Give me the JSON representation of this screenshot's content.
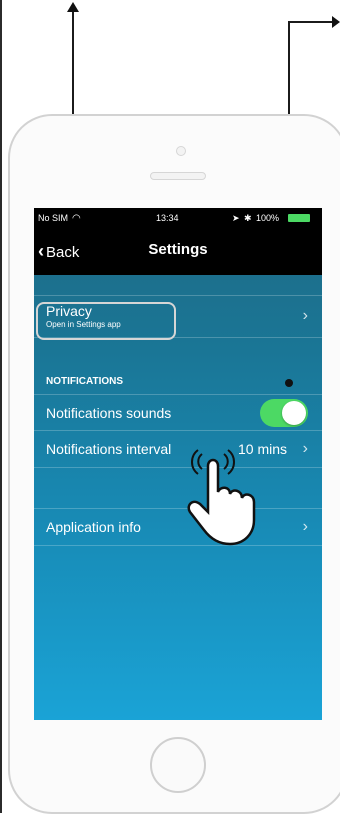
{
  "status_bar": {
    "carrier": "No SIM",
    "time": "13:34",
    "battery": "100%"
  },
  "nav": {
    "back_label": "Back",
    "title": "Settings"
  },
  "rows": {
    "privacy": {
      "title": "Privacy",
      "subtitle": "Open in Settings app"
    },
    "section_header": "NOTIFICATIONS",
    "sounds": {
      "label": "Notifications sounds",
      "enabled": true
    },
    "interval": {
      "label": "Notifications interval",
      "value": "10 mins"
    },
    "app_info": {
      "label": "Application info"
    }
  },
  "colors": {
    "toggle_on": "#4cd964",
    "screen_top": "#1f6b86",
    "screen_bottom": "#1aa3d6"
  }
}
